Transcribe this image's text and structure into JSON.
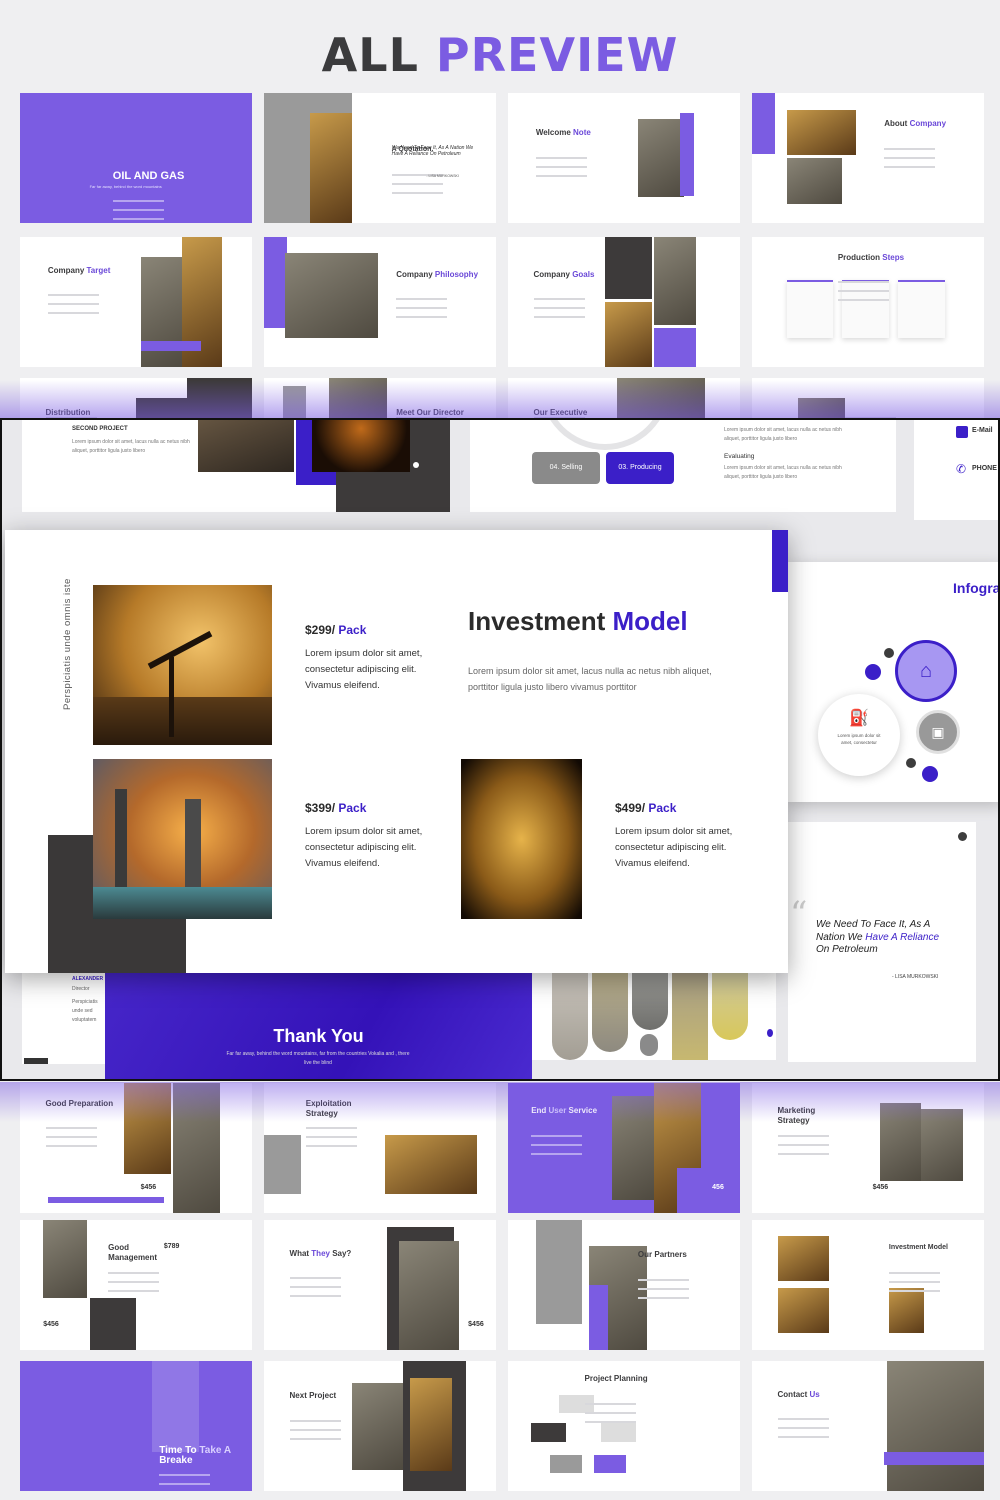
{
  "heading": {
    "part1": "ALL",
    "part2": "PREVIEW"
  },
  "colors": {
    "accent": "#7b5ce2",
    "deep_accent": "#3b1fc8",
    "dark": "#3b3b3d",
    "background": "#efeff1"
  },
  "thumbnails_top": [
    {
      "title": "OIL AND GAS",
      "accent": "",
      "subtitle": "Far far away, behind the word mountains"
    },
    {
      "title": "A Quotation.",
      "accent": "",
      "quote": "We Need To Face It, As A Nation We Have A Reliance On Petroleum",
      "author": "- LISA MURKOWSKI"
    },
    {
      "title": "Welcome ",
      "accent": "Note"
    },
    {
      "title": "About ",
      "accent": "Company"
    },
    {
      "title": "Company ",
      "accent": "Target"
    },
    {
      "title": "Company ",
      "accent": "Philosophy"
    },
    {
      "title": "Company ",
      "accent": "Goals"
    },
    {
      "title": "Production ",
      "accent": "Steps"
    },
    {
      "title": "Distribution",
      "accent": ""
    },
    {
      "title": "Meet Our Director",
      "accent": ""
    },
    {
      "title": "Our Executive",
      "accent": ""
    },
    {
      "title": "",
      "accent": ""
    }
  ],
  "band": {
    "second_project": {
      "label": "SECOND PROJECT",
      "text": "Lorem ipsum dolor sit amet, lacus nulla ac netus nibh aliquet, porttitor ligula justo libero"
    },
    "planning": {
      "selling": "04. Selling",
      "producing": "03. Producing",
      "evaluating": "Evaluating",
      "text1": "Lorem ipsum dolor sit amet, lacus nulla ac netus nibh aliquet, porttitor ligula justo libero",
      "text2": "Lorem ipsum dolor sit amet, lacus nulla ac netus nibh aliquet, porttitor ligula justo libero"
    },
    "contact": {
      "email": "E-Mail",
      "phone": "PHONE"
    },
    "main": {
      "vertical_text": "Perspiciatis unde omnis iste",
      "title": "Investment ",
      "title_accent": "Model",
      "description": "Lorem ipsum dolor sit amet, lacus nulla ac netus nibh aliquet, porttitor ligula justo libero vivamus porttitor",
      "packs": [
        {
          "price": "$299/ ",
          "unit": "Pack",
          "text": "Lorem ipsum dolor sit amet, consectetur adipiscing elit. Vivamus eleifend."
        },
        {
          "price": "$399/ ",
          "unit": "Pack",
          "text": "Lorem ipsum dolor sit amet, consectetur adipiscing elit. Vivamus eleifend."
        },
        {
          "price": "$499/ ",
          "unit": "Pack",
          "text": "Lorem ipsum dolor sit amet, consectetur adipiscing elit. Vivamus eleifend."
        }
      ]
    },
    "infographic": {
      "title": "Infogra",
      "circle_text": "Lorem ipsum dolor sit amet, consectetur"
    },
    "quote": {
      "line1": "We Need To Face It, As A",
      "line2a": "Nation We ",
      "line2b": "Have A Reliance",
      "line3": "On Petroleum",
      "author": "- LISA MURKOWSKI"
    },
    "director": {
      "name": "ALEXANDER",
      "role": "Director",
      "text": "Perspiciatis unde sed voluptatem"
    },
    "thankyou": {
      "title": "Thank You",
      "text": "Far far away, behind the word mountains, far from the countries Vokalia and , there live the blind"
    }
  },
  "thumbnails_bottom": [
    {
      "title": "Good Preparation",
      "accent": "",
      "value": "$456"
    },
    {
      "title": "Exploitation\nStrategy",
      "accent": ""
    },
    {
      "title": "End ",
      "accent": "User",
      "title_end": " Service",
      "value": "456"
    },
    {
      "title": "Marketing\nStrategy",
      "accent": "",
      "value": "$456"
    },
    {
      "title": "Good\nManagement",
      "accent": "",
      "value": "$789",
      "value2": "$456"
    },
    {
      "title": "What ",
      "accent": "They",
      "title_end": " Say?",
      "value": "$456"
    },
    {
      "title": "Our Partners",
      "accent": ""
    },
    {
      "title": "Investment Model",
      "accent": ""
    },
    {
      "title": "Time To ",
      "accent": "Take A",
      "title_end": "\nBreake"
    },
    {
      "title": "Next ",
      "accent": "",
      "title_end": "Project"
    },
    {
      "title": "Project Planning",
      "accent": ""
    },
    {
      "title": "Contact ",
      "accent": "Us"
    }
  ]
}
